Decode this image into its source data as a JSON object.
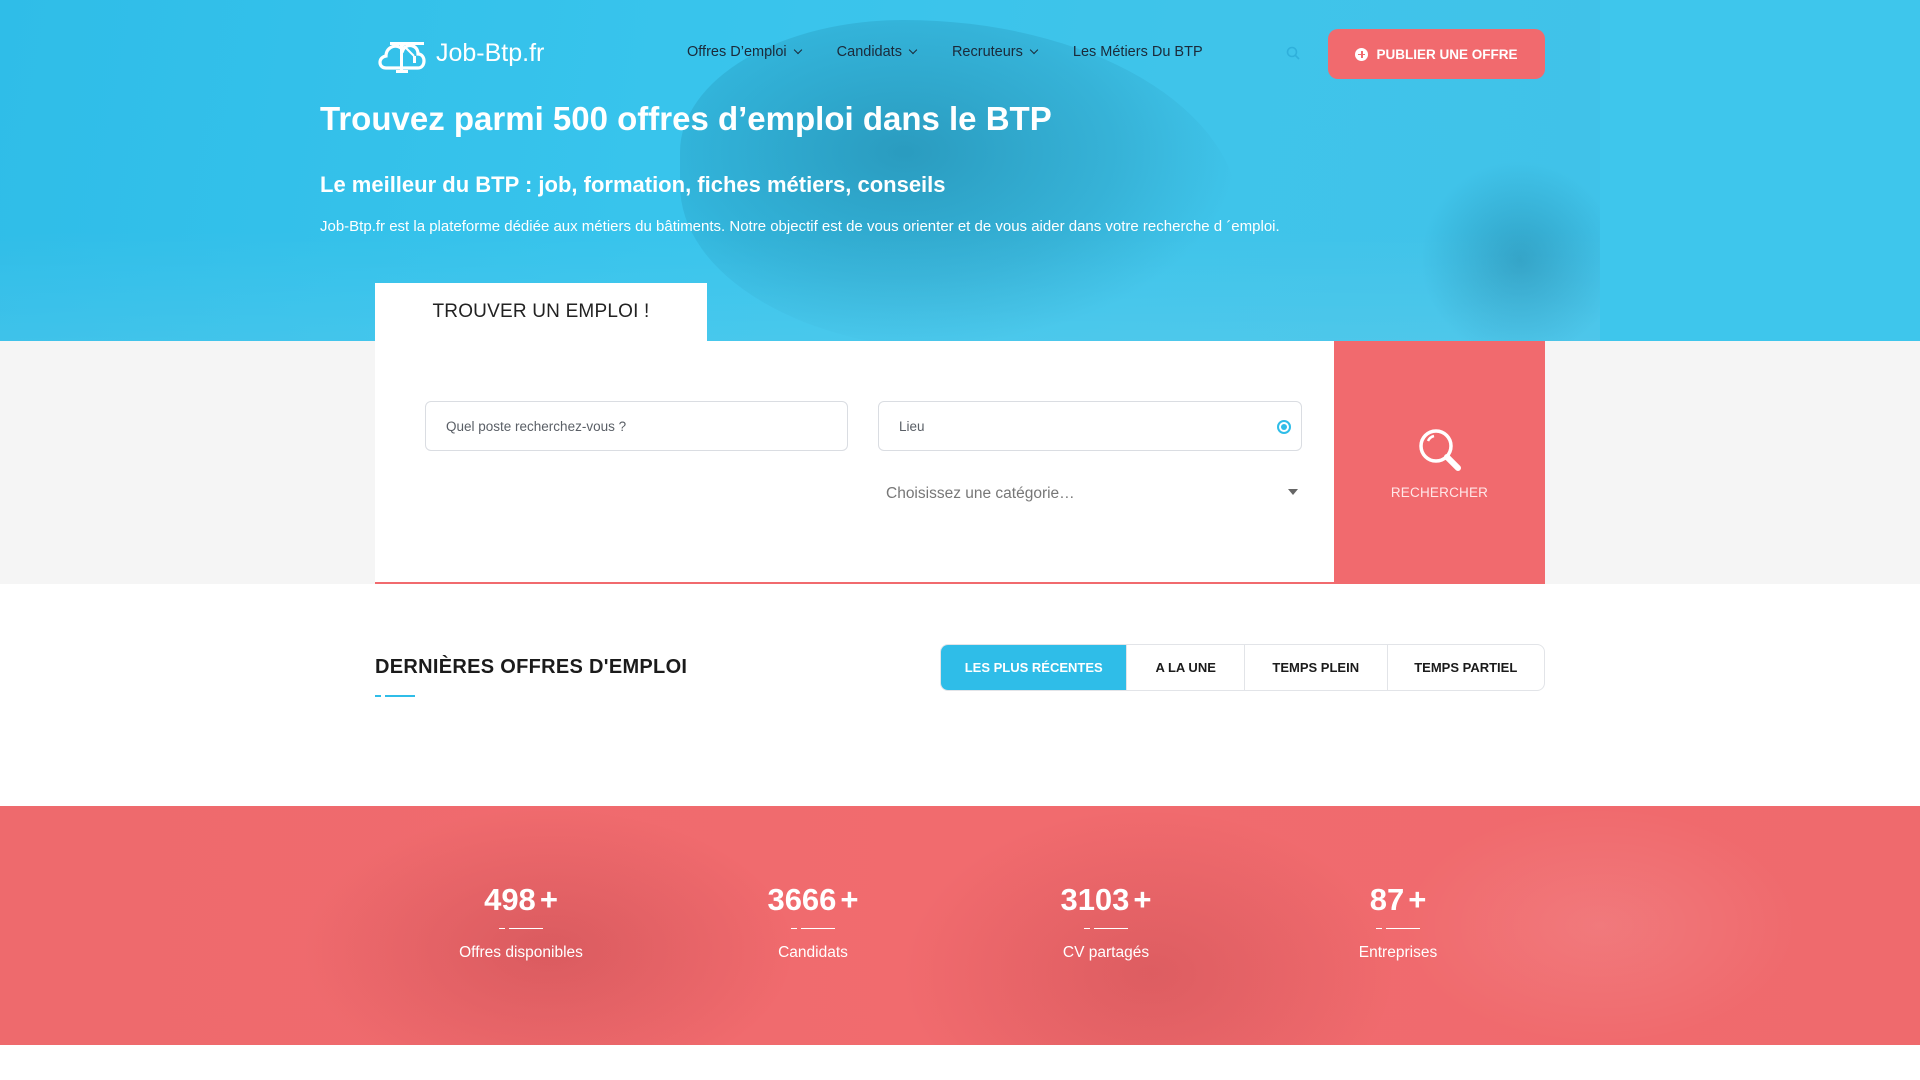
{
  "brand": {
    "name": "Job-Btp.fr",
    "logo_icon": "crane-cloud-icon"
  },
  "nav": {
    "items": [
      {
        "label": "Offres D’emploi",
        "has_dropdown": true
      },
      {
        "label": "Candidats",
        "has_dropdown": true
      },
      {
        "label": "Recruteurs",
        "has_dropdown": true
      },
      {
        "label": "Les Métiers Du BTP",
        "has_dropdown": false
      }
    ],
    "search_icon": "search-icon",
    "publish_label": "PUBLIER UNE OFFRE"
  },
  "hero": {
    "title": "Trouvez parmi 500 offres d’emploi dans le BTP",
    "subtitle": "Le meilleur du BTP : job, formation, fiches métiers, conseils",
    "description": "Job-Btp.fr est la plateforme dédiée aux métiers du bâtiments. Notre objectif est de vous orienter et de vous aider dans votre recherche d ´emploi."
  },
  "search": {
    "tab_label": "TROUVER UN EMPLOI !",
    "poste_placeholder": "Quel poste recherchez-vous ?",
    "lieu_placeholder": "Lieu",
    "category_placeholder": "Choisissez une catégorie…",
    "button_label": "RECHERCHER"
  },
  "latest": {
    "title": "DERNIÈRES OFFRES D'EMPLOI",
    "tabs": [
      {
        "label": "LES PLUS RÉCENTES",
        "active": true
      },
      {
        "label": "A LA UNE",
        "active": false
      },
      {
        "label": "TEMPS PLEIN",
        "active": false
      },
      {
        "label": "TEMPS PARTIEL",
        "active": false
      }
    ]
  },
  "stats": [
    {
      "value": "498",
      "suffix": "+",
      "label": "Offres disponibles"
    },
    {
      "value": "3666",
      "suffix": "+",
      "label": "Candidats"
    },
    {
      "value": "3103",
      "suffix": "+",
      "label": "CV partagés"
    },
    {
      "value": "87",
      "suffix": "+",
      "label": "Entreprises"
    }
  ],
  "colors": {
    "primary": "#2fbde8",
    "accent": "#f16a6e",
    "dark": "#1b2a3a"
  }
}
